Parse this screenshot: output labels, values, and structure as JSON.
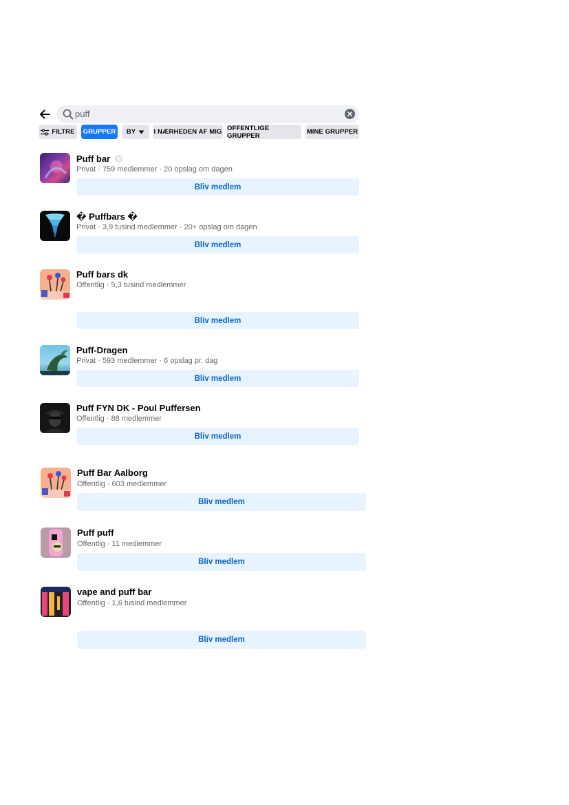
{
  "search": {
    "query": "puff",
    "back_icon": "arrow-left-icon",
    "search_icon": "magnifier-icon",
    "clear_icon": "clear-circle-icon"
  },
  "filters": {
    "filtre": "FILTRE",
    "grupper": "GRUPPER",
    "by": "BY",
    "naerheden": "I NÆRHEDEN AF MIG",
    "offentlige": "OFFENTLIGE GRUPPER",
    "mine": "MINE GRUPPER"
  },
  "join_label": "Bliv medlem",
  "groups": [
    {
      "name": "Puff bar",
      "meta": "Privat · 759 medlemmer · 20 opslag om dagen"
    },
    {
      "name": "� Puffbars �",
      "meta": "Privat · 3,9 tusind medlemmer · 20+ opslag om dagen"
    },
    {
      "name": "Puff bars dk",
      "meta": "Offentlig · 5,3 tusind medlemmer"
    },
    {
      "name": "Puff-Dragen",
      "meta": "Privat · 593 medlemmer · 6 opslag pr. dag"
    },
    {
      "name": "Puff FYN DK - Poul Puffersen",
      "meta": "Offentlig · 88 medlemmer"
    },
    {
      "name": "Puff Bar Aalborg",
      "meta": "Offentlig · 603 medlemmer"
    },
    {
      "name": "Puff puff",
      "meta": "Offentlig · 11 medlemmer"
    },
    {
      "name": "vape and puff bar",
      "meta": "Offentlig · 1,6 tusind medlemmer"
    }
  ],
  "colors": {
    "accent": "#1877f2",
    "join_bg": "#e7f3ff",
    "join_text": "#0a66c2",
    "chip_bg": "#e4e6eb"
  }
}
